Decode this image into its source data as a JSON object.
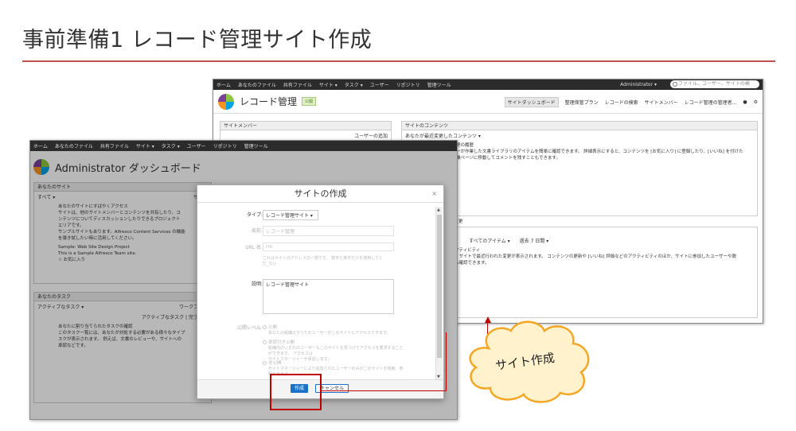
{
  "slide": {
    "title": "事前準備1 レコード管理サイト作成"
  },
  "back_window": {
    "nav": [
      "ホーム",
      "あなたのファイル",
      "共有ファイル",
      "サイト ▾",
      "タスク ▾",
      "ユーザー",
      "リポジトリ",
      "管理ツール"
    ],
    "user": "Administrator ▾",
    "search_placeholder": "ファイル、ユーザー、サイトの検",
    "site_name": "レコード管理",
    "badge": "公開",
    "site_nav": [
      "サイトダッシュボード",
      "整理保管プラン",
      "レコードの検索",
      "サイトメンバー",
      "レコード管理の管理者..."
    ],
    "members_title": "サイトメンバー",
    "add_user": "ユーザーの追加",
    "content_title": "サイトのコンテンツ",
    "content_filter": "あなたが最近変更したコンテンツ ▾",
    "history_title": "更の履歴",
    "history_text": "ーが作業した文書ライブラリのアイテムを簡単に確認できます。 詳細表示にすると、コンテンツを [お気に入り] に登録したり、[いいね] を付けた\n機ページに移動してコメントを残すこともできます。",
    "activity_filter_1": "すべてのアイテム ▾",
    "activity_filter_2": "過去 7 日間 ▾",
    "activity_title": "クティビティ",
    "activity_text": "、サイトで最近行われた変更が表示されます。 コンテンツの更新や [いいね] 評価などのアクティビティのほか、サイトに参加したユーザーや脱\nも確認できます。",
    "side_label": "た変更",
    "side_label_2": "すべ"
  },
  "front_window": {
    "nav": [
      "ホーム",
      "あなたのファイル",
      "共有ファイル",
      "サイト ▾",
      "タスク ▾",
      "ユーザー",
      "リポジトリ",
      "管理ツール"
    ],
    "title": "Administrator ダッシュボード",
    "sites_title": "あなたのサイト",
    "sites_filter": "すべて ▾",
    "sites_right": "サイト",
    "access_title": "あなたのサイトにすばやくアクセス",
    "access_text": "サイトは、他のサイトメンバーとコンテンツを共有したり、コ\nンテンツについてディスカッションしたりできるプロジェクト\nエリアです。\nサンプルサイトもあります。Alfresco Content Services の機能\nを導き試したい時に活用してください。",
    "sample_title": "Sample: Web Site Design Project",
    "sample_desc": "This is a Sample Alfresco Team site.",
    "favorite": "☆ お気に入り",
    "tasks_title": "あなたのタスク",
    "tasks_filter": "アクティブなタスク ▾",
    "workflow": "ワークフロー",
    "tasks_meta": "アクティブなタスク | 完了済み",
    "task_title": "あなたに割り当てられたタスクの確認",
    "task_text": "このタスク一覧には、あなたが対処する必要がある様々なタイプ\nスクが表示されます。 例えば、文書のレビューや、サイトへの\n承認などです。"
  },
  "dialog": {
    "title": "サイトの作成",
    "close": "×",
    "type_label": "タイプ:",
    "type_value": "レコード管理サイト",
    "name_label": "名前:",
    "name_value": "レコード管理",
    "url_label": "URL 名:",
    "url_value": "rm",
    "url_hint": "これはサイトのアドレスの一部です。 数字と英字だけを使用してく\nだ_ない",
    "desc_label": "説明:",
    "desc_value": "レコード管理サイト",
    "visibility_label": "公開レベル:",
    "options": [
      {
        "label": "公開",
        "hint": "あなたの組織のすべてのユーザーがこのサイトにアクセスできます。"
      },
      {
        "label": "承認付き公開",
        "hint": "組織内のいずれのユーザーもこのサイトを見つけてアクセスを要求することができます。 アクセスは\nサイトマネージャーが承認します。"
      },
      {
        "label": "非公開",
        "hint": "サイトマネージャーにより追加されたユーザーのみがこのサイトを検索、参照できます。"
      }
    ],
    "create_button": "作成",
    "cancel_button": "キャンセル"
  },
  "callout": {
    "text": "サイト作成"
  },
  "colors": {
    "accent": "#c0504d",
    "callout_fill": "#fff2cc",
    "callout_stroke": "#f5a623",
    "button": "#1a73c8"
  }
}
